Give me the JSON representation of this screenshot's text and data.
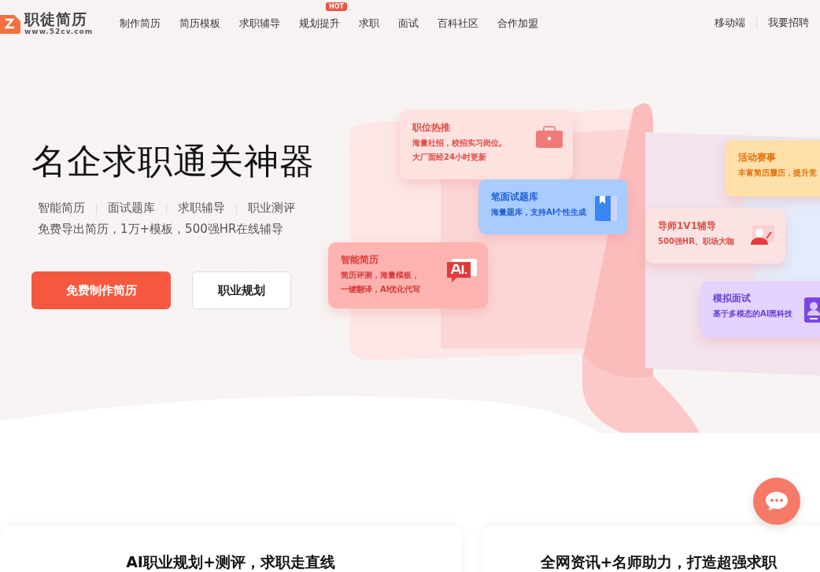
{
  "nav": {
    "logo": {
      "name": "职徒简历",
      "url": "www.52cv.com"
    },
    "items": [
      {
        "label": "制作简历"
      },
      {
        "label": "简历模板"
      },
      {
        "label": "求职辅导"
      },
      {
        "label": "规划提升",
        "badge": "HOT"
      },
      {
        "label": "求职"
      },
      {
        "label": "面试"
      },
      {
        "label": "百科社区"
      },
      {
        "label": "合作加盟"
      }
    ],
    "right_links": [
      "移动端",
      "我要招聘"
    ]
  },
  "hero": {
    "title": "名企求职通关神器",
    "features": [
      "智能简历",
      "面试题库",
      "求职辅导",
      "职业测评"
    ],
    "subtitle": "免费导出简历，1万+模板，500强HR在线辅导",
    "buttons": [
      {
        "label": "免费制作简历",
        "kind": "primary"
      },
      {
        "label": "职业规划",
        "kind": "secondary"
      }
    ]
  },
  "feature_cards": [
    {
      "title": "职位热推",
      "lines": [
        "海量社招，校招实习岗位,",
        "大厂面经24小时更新"
      ],
      "kind": "briefcase",
      "color": "#e04a44"
    },
    {
      "title": "笔面试题库",
      "lines": [
        "海量题库，支持AI个性生成"
      ],
      "kind": "book",
      "color": "#1f5fd8"
    },
    {
      "title": "智能简历",
      "lines": [
        "简历评测，海量模板，",
        "一键翻译，AI优化代写"
      ],
      "kind": "ai",
      "color": "#d8383a"
    },
    {
      "title": "活动赛事",
      "lines": [
        "丰富简历履历，提升竞"
      ],
      "kind": "none",
      "color": "#e2720e"
    },
    {
      "title": "导师1V1辅导",
      "lines": [
        "500强HR、职场大咖"
      ],
      "kind": "mentor",
      "color": "#d9504a"
    },
    {
      "title": "模拟面试",
      "lines": [
        "基于多模态的AI黑科技"
      ],
      "kind": "profile",
      "color": "#6a3ed4"
    }
  ],
  "sections": [
    {
      "title": "AI职业规划+测评，求职走直线"
    },
    {
      "title": "全网资讯+名师助力，打造超强求职"
    }
  ]
}
